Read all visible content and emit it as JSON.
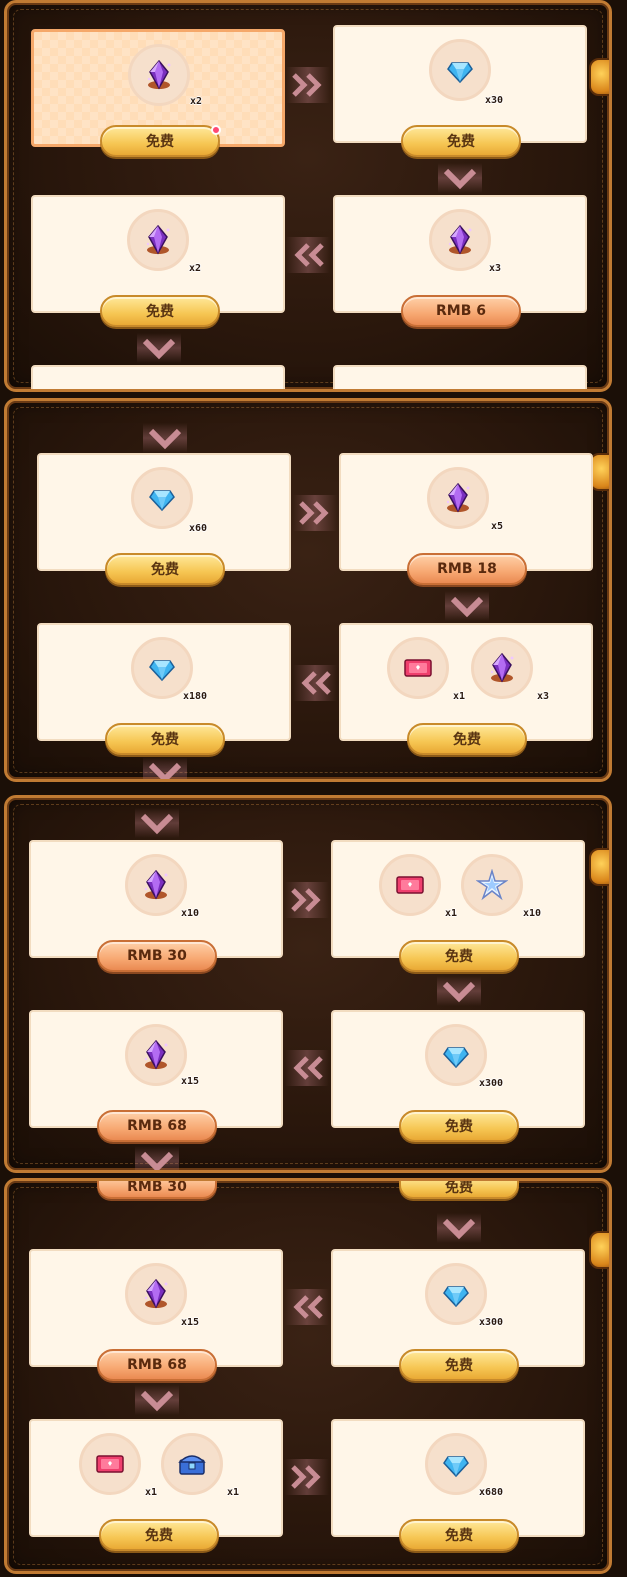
{
  "labels": {
    "free": "免费",
    "rmb6": "RMB 6",
    "rmb18": "RMB 18",
    "rmb30": "RMB 30",
    "rmb68": "RMB 68"
  },
  "quantities": {
    "x1": "x1",
    "x2": "x2",
    "x3": "x3",
    "x5": "x5",
    "x10": "x10",
    "x15": "x15",
    "x30": "x30",
    "x60": "x60",
    "x180": "x180",
    "x300": "x300",
    "x680": "x680"
  },
  "icons": {
    "purple_gem": "purple-crystal-icon",
    "blue_gem": "blue-diamond-icon",
    "ticket": "pink-ticket-icon",
    "star_shard": "star-shard-icon",
    "chest": "blue-chest-icon"
  },
  "colors": {
    "frame": "#c17b33",
    "card": "#fff6e8",
    "active_card": "#ffddb8",
    "free_button": "#f6c653",
    "rmb_button": "#f7a872",
    "notification": "#ff4a73"
  }
}
